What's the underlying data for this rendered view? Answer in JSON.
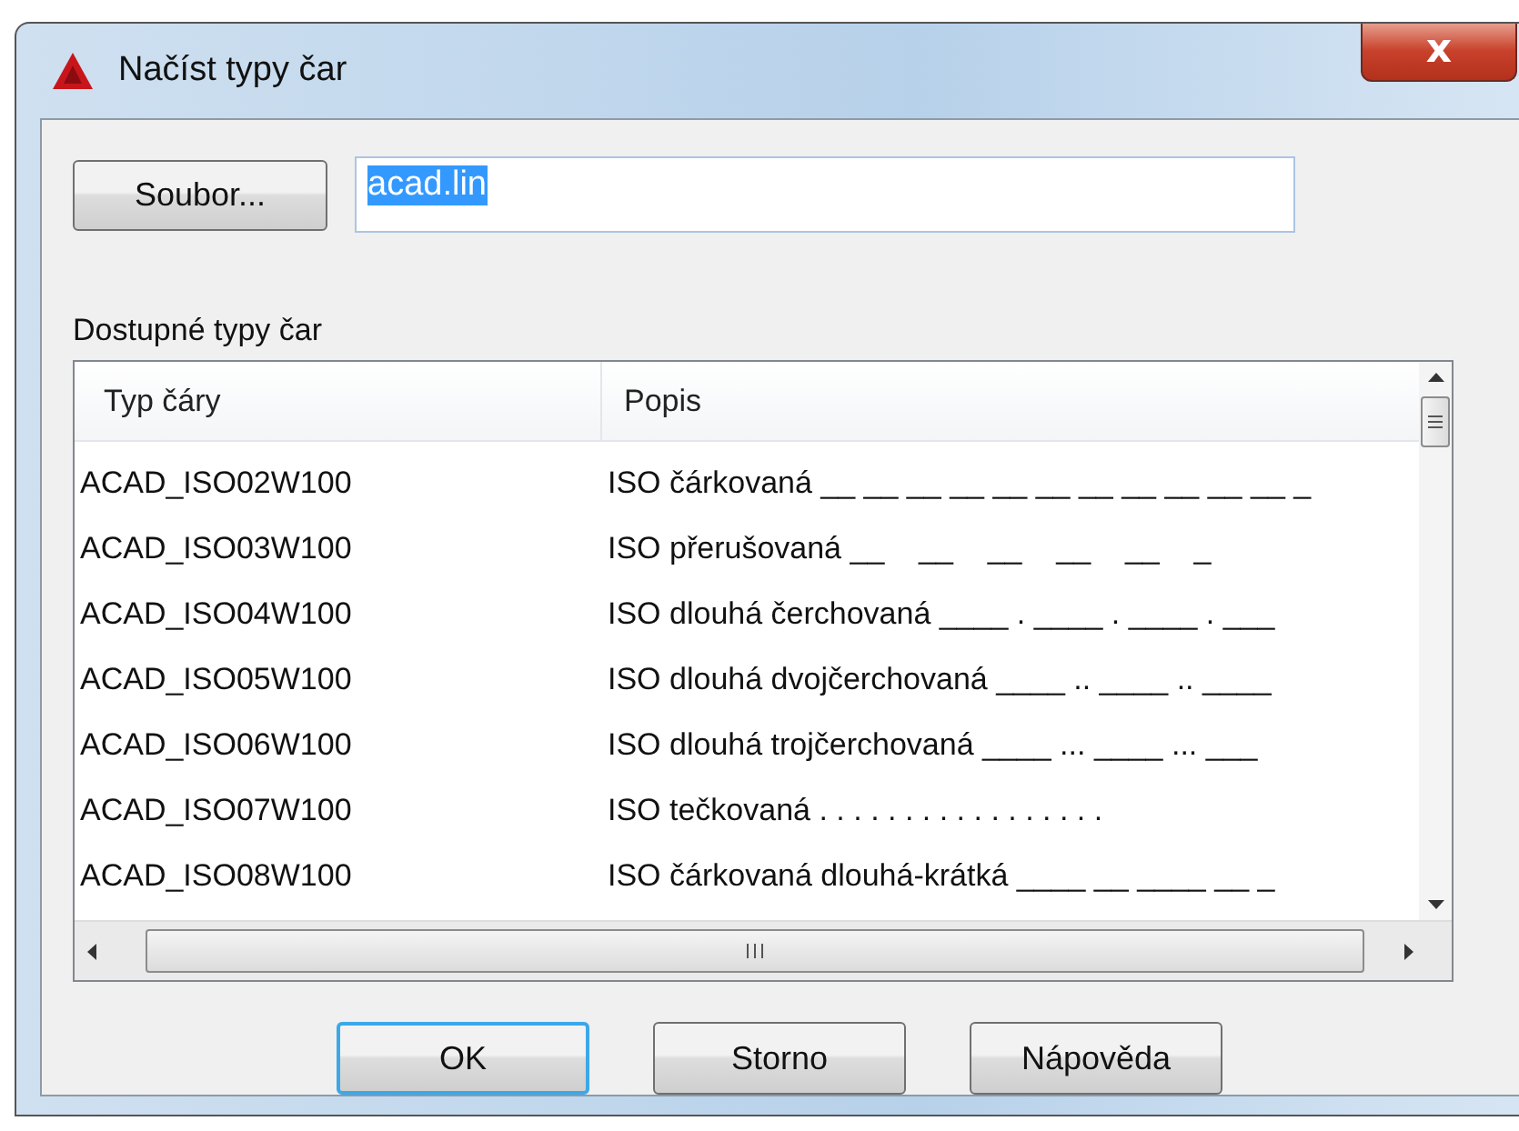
{
  "window": {
    "title": "Načíst typy čar",
    "close": "x"
  },
  "file_button": "Soubor...",
  "file_field": {
    "value": "acad.lin",
    "selected": true
  },
  "list": {
    "label": "Dostupné typy čar",
    "columns": [
      "Typ čáry",
      "Popis"
    ],
    "rows": [
      {
        "name": "ACAD_ISO02W100",
        "description": "ISO čárkovaná __ __ __ __ __ __ __ __ __ __ __ _"
      },
      {
        "name": "ACAD_ISO03W100",
        "description": "ISO přerušovaná __    __    __    __    __    _"
      },
      {
        "name": "ACAD_ISO04W100",
        "description": "ISO dlouhá čerchovaná ____ . ____ . ____ . ___"
      },
      {
        "name": "ACAD_ISO05W100",
        "description": "ISO dlouhá dvojčerchovaná ____ .. ____ .. ____"
      },
      {
        "name": "ACAD_ISO06W100",
        "description": "ISO dlouhá trojčerchovaná ____ ... ____ ... ___"
      },
      {
        "name": "ACAD_ISO07W100",
        "description": "ISO tečkovaná . . . . . . . . . . . . . . . . ."
      },
      {
        "name": "ACAD_ISO08W100",
        "description": "ISO čárkovaná dlouhá-krátká ____ __ ____ __ _"
      }
    ]
  },
  "buttons": [
    {
      "label": "OK",
      "default": true
    },
    {
      "label": "Storno",
      "default": false
    },
    {
      "label": "Nápověda",
      "default": false
    }
  ]
}
